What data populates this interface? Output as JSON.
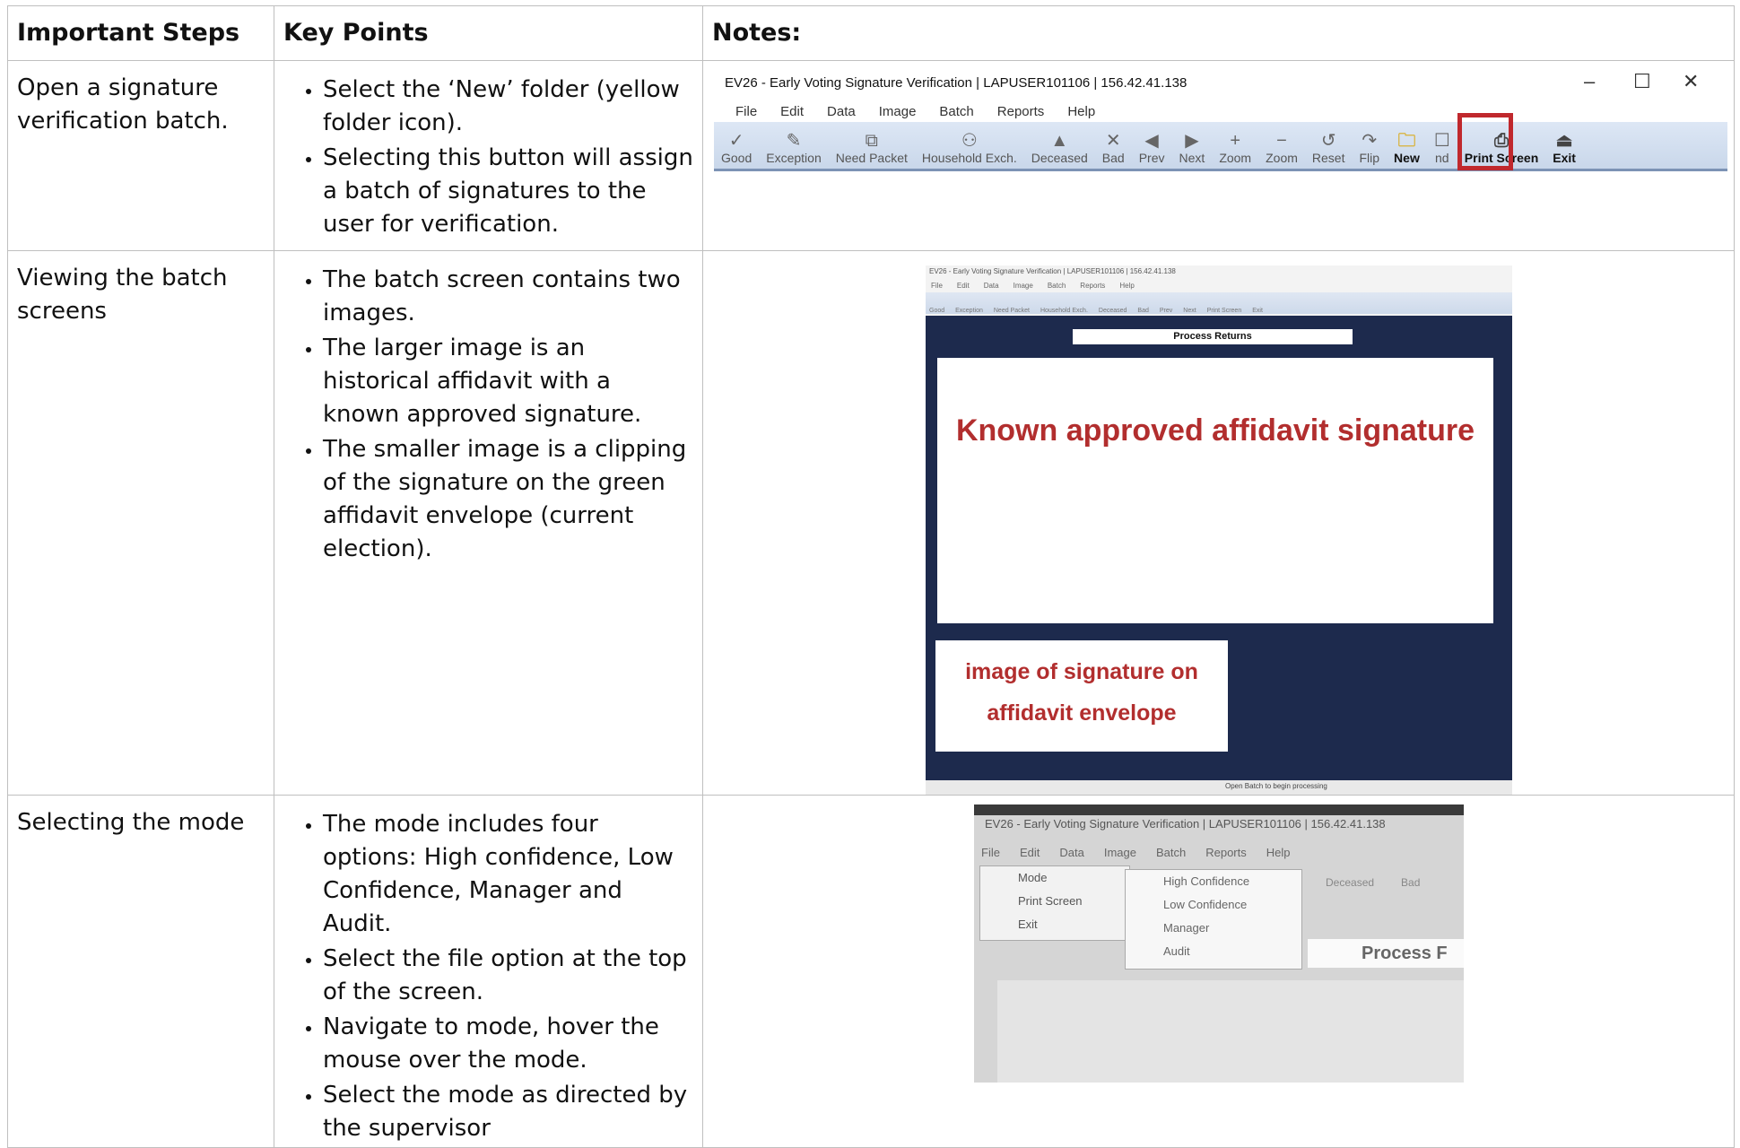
{
  "headers": {
    "steps": "Important Steps",
    "key_points": "Key Points",
    "notes": "Notes:"
  },
  "rows": [
    {
      "step": "Open a signature verification batch.",
      "points": [
        "Select the ‘New’ folder (yellow folder icon).",
        "Selecting this button will assign a batch of signatures to the user for verification."
      ]
    },
    {
      "step": "Viewing the batch screens",
      "points": [
        "The batch screen contains two images.",
        "The larger image is an historical affidavit with a known approved signature.",
        "The smaller image is a clipping of the signature on the green affidavit envelope (current election)."
      ]
    },
    {
      "step": "Selecting the mode",
      "points": [
        "The mode includes four options: High confidence, Low Confidence, Manager and Audit.",
        "Select the file option at the top of the screen.",
        "Navigate to mode, hover the mouse over the mode.",
        "Select the mode as directed by the supervisor"
      ]
    }
  ],
  "window": {
    "title": "EV26 - Early Voting Signature Verification | LAPUSER101106 | 156.42.41.138",
    "menu": [
      "File",
      "Edit",
      "Data",
      "Image",
      "Batch",
      "Reports",
      "Help"
    ],
    "toolbar": [
      "Good",
      "Exception",
      "Need Packet",
      "Household Exch.",
      "Deceased",
      "Bad",
      "Prev",
      "Next",
      "Zoom",
      "Zoom",
      "Reset",
      "Flip",
      "New",
      "nd",
      "Print Screen",
      "Exit"
    ]
  },
  "batch_screen": {
    "process_label": "Process Returns",
    "big_image_label": "Known approved affidavit signature",
    "small_image_label": "image of signature on affidavit envelope",
    "status": "Open Batch to begin processing"
  },
  "mode_menu": {
    "title": "EV26 - Early Voting Signature Verification | LAPUSER101106 | 156.42.41.138",
    "menu": [
      "File",
      "Edit",
      "Data",
      "Image",
      "Batch",
      "Reports",
      "Help"
    ],
    "file_items": [
      "Mode",
      "Print Screen",
      "Exit"
    ],
    "mode_items": [
      "High Confidence",
      "Low Confidence",
      "Manager",
      "Audit"
    ],
    "process_label": "Process F"
  }
}
